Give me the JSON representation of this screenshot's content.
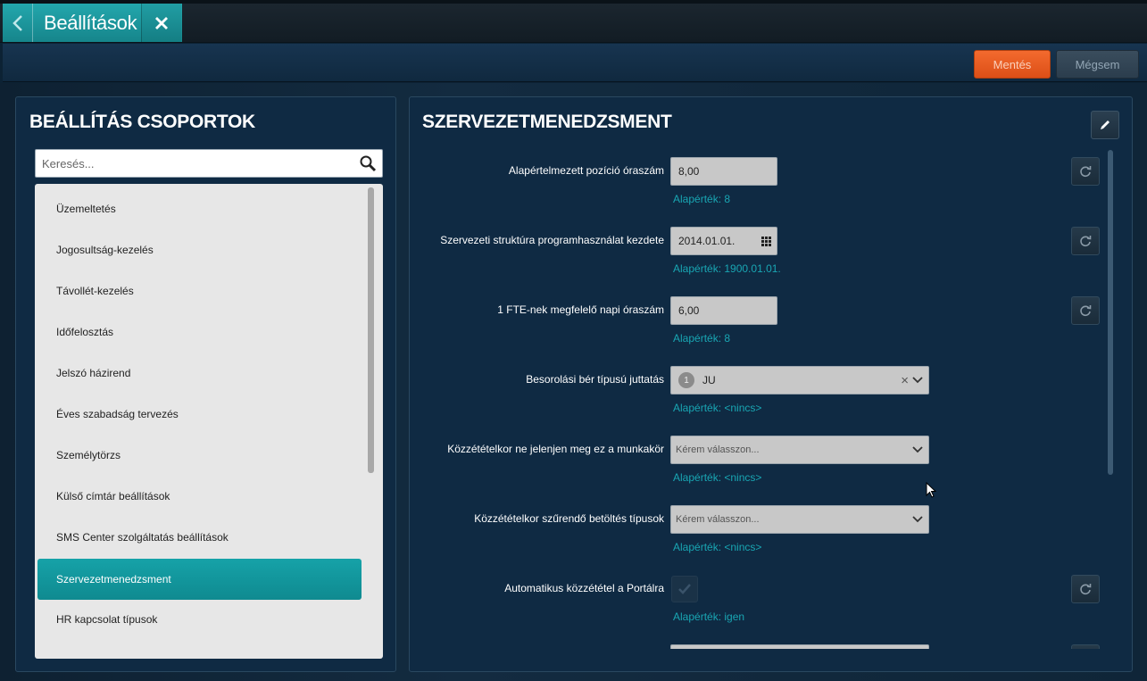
{
  "header": {
    "title": "Beállítások"
  },
  "toolbar": {
    "save_label": "Mentés",
    "cancel_label": "Mégsem"
  },
  "left": {
    "title": "BEÁLLÍTÁS CSOPORTOK",
    "search_placeholder": "Keresés...",
    "items": [
      {
        "label": "Üzemeltetés"
      },
      {
        "label": "Jogosultság-kezelés"
      },
      {
        "label": "Távollét-kezelés"
      },
      {
        "label": "Időfelosztás"
      },
      {
        "label": "Jelszó házirend"
      },
      {
        "label": "Éves szabadság tervezés"
      },
      {
        "label": "Személytörzs"
      },
      {
        "label": "Külső címtár beállítások"
      },
      {
        "label": "SMS Center szolgáltatás beállítások"
      },
      {
        "label": "Szervezetmenedzsment",
        "selected": true
      },
      {
        "label": "HR kapcsolat típusok"
      }
    ]
  },
  "right": {
    "title": "SZERVEZETMENEDZSMENT",
    "settings": [
      {
        "label": "Alapértelmezett pozíció óraszám",
        "value": "8,00",
        "default": "Alapérték: 8"
      },
      {
        "label": "Szervezeti struktúra programhasználat kezdete",
        "value": "2014.01.01.",
        "default": "Alapérték: 1900.01.01."
      },
      {
        "label": "1 FTE-nek megfelelő napi óraszám",
        "value": "6,00",
        "default": "Alapérték: 8"
      },
      {
        "label": "Besorolási bér típusú juttatás",
        "count": "1",
        "value": "JU",
        "clear": "×",
        "default": "Alapérték: <nincs>"
      },
      {
        "label": "Közzétételkor ne jelenjen meg ez a munkakör",
        "placeholder": "Kérem válasszon...",
        "default": "Alapérték: <nincs>"
      },
      {
        "label": "Közzétételkor szűrendő betöltés típusok",
        "placeholder": "Kérem válasszon...",
        "default": "Alapérték: <nincs>"
      },
      {
        "label": "Automatikus közzététel a Portálra",
        "checked": true,
        "default": "Alapérték: igen"
      }
    ]
  },
  "colors": {
    "accent_teal": "#16a2a8",
    "save_orange": "#e85a20",
    "default_text": "#19a6b3"
  }
}
